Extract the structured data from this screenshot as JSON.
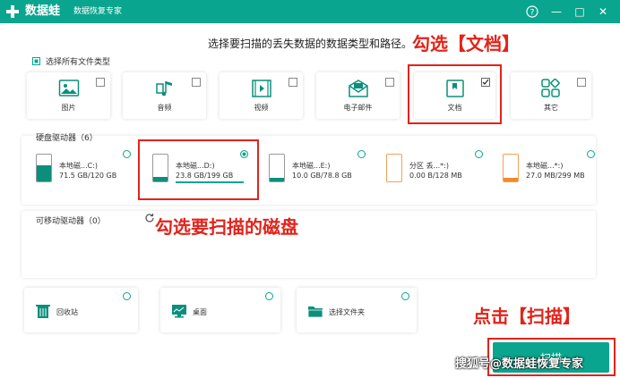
{
  "titlebar": {
    "app_name": "数据蛙",
    "subtitle": "数据恢复专家",
    "help_icon": "?",
    "min_icon": "—",
    "max_icon": "□",
    "close_icon": "✕"
  },
  "heading": "选择要扫描的丢失数据的数据类型和路径。",
  "select_all_label": "选择所有文件类型",
  "file_types": [
    {
      "label": "图片",
      "checked": false,
      "icon": "image-icon"
    },
    {
      "label": "音频",
      "checked": false,
      "icon": "music-icon"
    },
    {
      "label": "视频",
      "checked": false,
      "icon": "video-icon"
    },
    {
      "label": "电子邮件",
      "checked": false,
      "icon": "email-icon"
    },
    {
      "label": "文档",
      "checked": true,
      "icon": "document-icon"
    },
    {
      "label": "其它",
      "checked": false,
      "icon": "other-icon"
    }
  ],
  "hdd_section": {
    "title": "硬盘驱动器（6）",
    "drives": [
      {
        "name": "本地磁...C:)",
        "size": "71.5 GB/120 GB",
        "selected": false,
        "used_fraction": 0.6,
        "color": "#0b8f7c"
      },
      {
        "name": "本地磁...D:)",
        "size": "23.8 GB/199 GB",
        "selected": true,
        "used_fraction": 0.12,
        "color": "#0b8f7c"
      },
      {
        "name": "本地磁...E:)",
        "size": "10.0 GB/78.8 GB",
        "selected": false,
        "used_fraction": 0.13,
        "color": "#0b8f7c"
      },
      {
        "name": "分区 丢...*:)",
        "size": "0.00  B/128 MB",
        "selected": false,
        "used_fraction": 0.0,
        "color": "#f08a2a"
      },
      {
        "name": "本地磁...*:)",
        "size": "27.0 MB/299 MB",
        "selected": false,
        "used_fraction": 0.09,
        "color": "#f08a2a"
      }
    ]
  },
  "removable_section": {
    "title": "可移动驱动器（0）"
  },
  "locations": [
    {
      "label": "回收站",
      "icon": "recycle-bin-icon"
    },
    {
      "label": "桌面",
      "icon": "desktop-icon"
    },
    {
      "label": "选择文件夹",
      "icon": "folder-icon"
    }
  ],
  "scan_button_label": "扫描",
  "annotations": {
    "check_docs": "勾选【文档】",
    "check_disk": "勾选要扫描的磁盘",
    "click_scan": "点击【扫描】"
  },
  "watermark": "搜狐号@数据蛙恢复专家",
  "colors": {
    "accent": "#0aa58f",
    "annotation": "#e2231a",
    "drive_orange": "#f08a2a"
  }
}
